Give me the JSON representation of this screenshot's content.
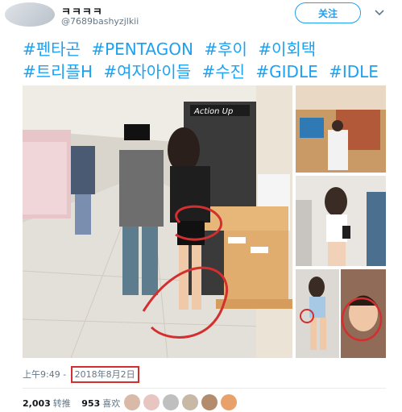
{
  "header": {
    "display_name": "ㅋㅋㅋㅋ",
    "handle": "@7689bashyzjlkii",
    "follow_label": "关注",
    "menu_icon": "chevron-down-icon"
  },
  "tweet": {
    "hashtags": [
      "#펜타곤",
      "#PENTAGON",
      "#후이",
      "#이회택",
      "#트리플H",
      "#여자아이들",
      "#수진",
      "#GIDLE",
      "#IDLE"
    ],
    "storefront_sign": "Action Up"
  },
  "footer": {
    "time": "上午9:49",
    "separator": " - ",
    "date": "2018年8月2日",
    "retweets": "2,003",
    "retweets_label": "转推",
    "likes": "953",
    "likes_label": "喜欢"
  },
  "colors": {
    "accent": "#1da1f2",
    "highlight": "#d32f2f"
  }
}
